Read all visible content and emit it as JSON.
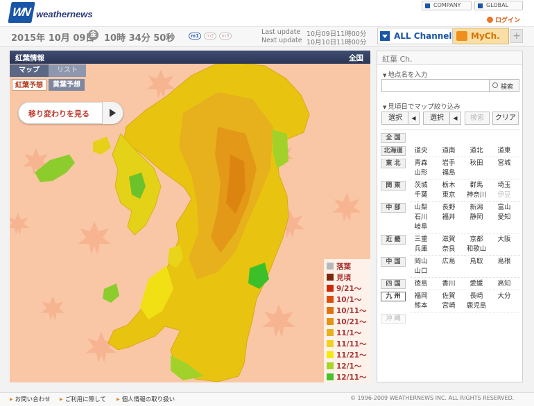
{
  "header": {
    "logo_mark": "WN",
    "logo_text": "weathernews",
    "company_link": "COMPANY",
    "global_link": "GLOBAL",
    "login": "ログイン"
  },
  "datebar": {
    "date": "2015年 10月 09日",
    "day": "金",
    "time": "10時 34分 50秒",
    "modes": [
      "m1",
      "m2",
      "m3"
    ],
    "last_update_label": "Last update",
    "last_update": "10月09日11時00分",
    "next_update_label": "Next update",
    "next_update": "10月10日11時00分",
    "all_channel": "ALL Channel",
    "my_ch": "MyCh.",
    "plus": "+"
  },
  "map": {
    "title": "紅葉情報",
    "region_label": "全国",
    "view_tabs": [
      "マップ",
      "リスト"
    ],
    "sub_tabs": [
      "紅葉予想",
      "黄葉予想"
    ],
    "change_button": "移り変わりを見る",
    "legend": [
      {
        "label": "落葉",
        "color": "#b8b8b8"
      },
      {
        "label": "見頃",
        "color": "#7a2a0a"
      },
      {
        "label": "9/21～",
        "color": "#cc2a08"
      },
      {
        "label": "10/1～",
        "color": "#d8500a"
      },
      {
        "label": "10/11～",
        "color": "#de7410"
      },
      {
        "label": "10/21～",
        "color": "#e39418"
      },
      {
        "label": "11/1～",
        "color": "#e8b020"
      },
      {
        "label": "11/11～",
        "color": "#efd024"
      },
      {
        "label": "11/21～",
        "color": "#f2ea10"
      },
      {
        "label": "12/1～",
        "color": "#a6d62a"
      },
      {
        "label": "12/11～",
        "color": "#46c22a"
      }
    ]
  },
  "panel": {
    "title": "紅葉 Ch.",
    "place_section": "地点名を入力",
    "search_placeholder": "",
    "search_button": "検索",
    "filter_section": "見頃日でマップ絞り込み",
    "select1": "選択",
    "select2": "選択",
    "filter_search": "検索",
    "clear": "クリア",
    "regions": [
      {
        "name": "全 国",
        "prefs": []
      },
      {
        "name": "北海道",
        "prefs": [
          "道央",
          "道南",
          "道北",
          "道東"
        ]
      },
      {
        "name": "東 北",
        "prefs": [
          "青森",
          "岩手",
          "秋田",
          "宮城",
          "山形",
          "福島"
        ]
      },
      {
        "name": "関 東",
        "prefs": [
          "茨城",
          "栃木",
          "群馬",
          "埼玉",
          "千葉",
          "東京",
          "神奈川",
          "伊豆"
        ]
      },
      {
        "name": "中 部",
        "prefs": [
          "山梨",
          "長野",
          "新潟",
          "富山",
          "石川",
          "福井",
          "静岡",
          "愛知",
          "岐阜"
        ]
      },
      {
        "name": "近 畿",
        "prefs": [
          "三重",
          "滋賀",
          "京都",
          "大阪",
          "兵庫",
          "奈良",
          "和歌山"
        ]
      },
      {
        "name": "中 国",
        "prefs": [
          "岡山",
          "広島",
          "鳥取",
          "島根",
          "山口"
        ]
      },
      {
        "name": "四 国",
        "prefs": [
          "徳島",
          "香川",
          "愛媛",
          "高知"
        ]
      },
      {
        "name": "九 州",
        "prefs": [
          "福岡",
          "佐賀",
          "長崎",
          "大分",
          "熊本",
          "宮崎",
          "鹿児島"
        ]
      },
      {
        "name": "沖 縄",
        "prefs": []
      }
    ]
  },
  "footer": {
    "links": [
      "お問い合わせ",
      "ご利用に際して",
      "個人情報の取り扱い"
    ],
    "copyright": "© 1996-2009 WEATHERNEWS INC. ALL RIGHTS RESERVED."
  }
}
